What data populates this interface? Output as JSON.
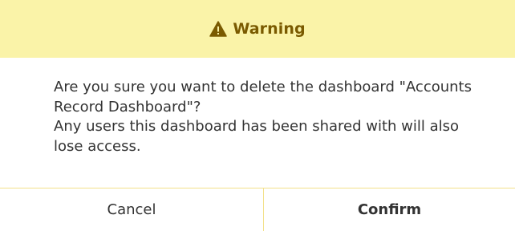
{
  "header": {
    "title": "Warning",
    "icon": "warning-triangle-icon",
    "background": "#faf3a8",
    "title_color": "#7a5a00"
  },
  "message": {
    "line1": "Are you sure you want to delete the dashboard \"Accounts Record Dashboard\"?",
    "line2": "Any users this dashboard has been shared with will also lose access."
  },
  "actions": {
    "cancel_label": "Cancel",
    "confirm_label": "Confirm"
  },
  "colors": {
    "divider": "#f3e08a",
    "text": "#333333"
  }
}
